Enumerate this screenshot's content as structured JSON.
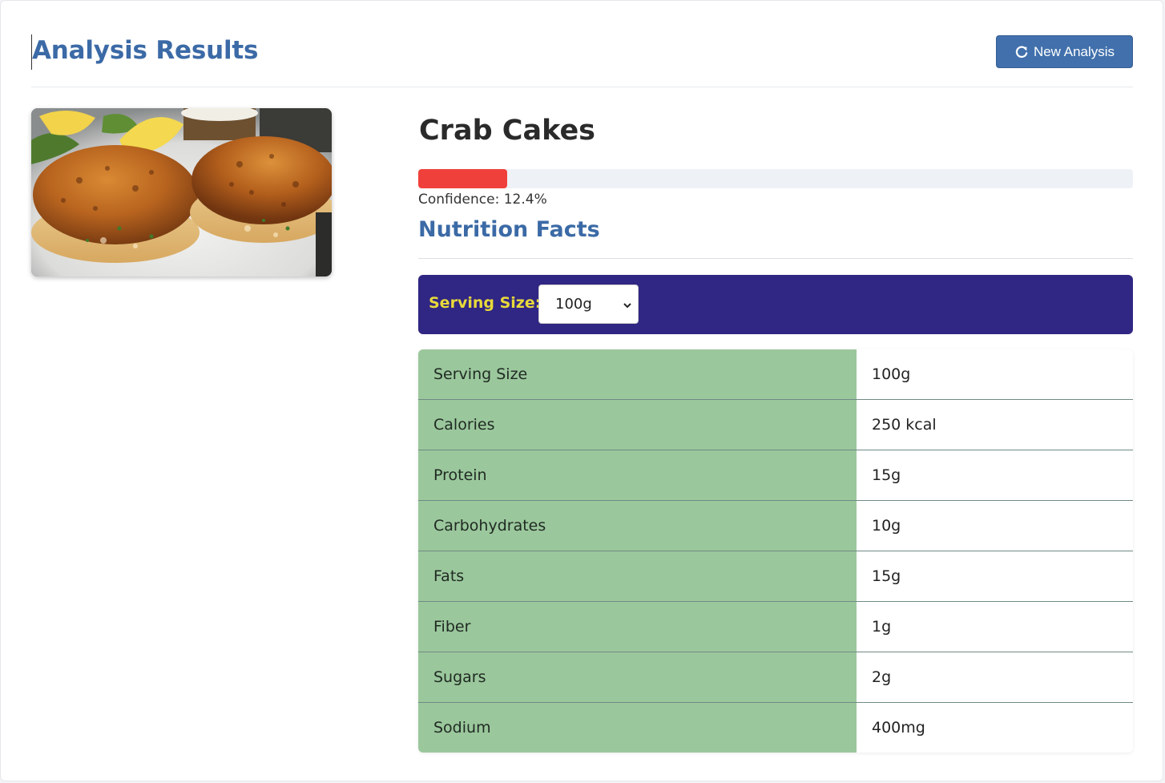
{
  "header": {
    "title": "Analysis Results",
    "new_analysis_label": "New Analysis",
    "new_analysis_icon": "refresh-icon"
  },
  "result": {
    "food_name": "Crab Cakes",
    "confidence_percent": 12.4,
    "confidence_text": "Confidence: 12.4%",
    "confidence_color": "#f0403b"
  },
  "nutrition": {
    "title": "Nutrition Facts",
    "serving_label": "Serving Size:",
    "serving_selected": "100g",
    "rows": [
      {
        "label": "Serving Size",
        "value": "100g"
      },
      {
        "label": "Calories",
        "value": "250 kcal"
      },
      {
        "label": "Protein",
        "value": "15g"
      },
      {
        "label": "Carbohydrates",
        "value": "10g"
      },
      {
        "label": "Fats",
        "value": "15g"
      },
      {
        "label": "Fiber",
        "value": "1g"
      },
      {
        "label": "Sugars",
        "value": "2g"
      },
      {
        "label": "Sodium",
        "value": "400mg"
      }
    ]
  },
  "colors": {
    "accent": "#3b6aa6",
    "serving_bar": "#302683",
    "serving_label": "#e8d93a",
    "label_cell": "#9bc79c"
  }
}
